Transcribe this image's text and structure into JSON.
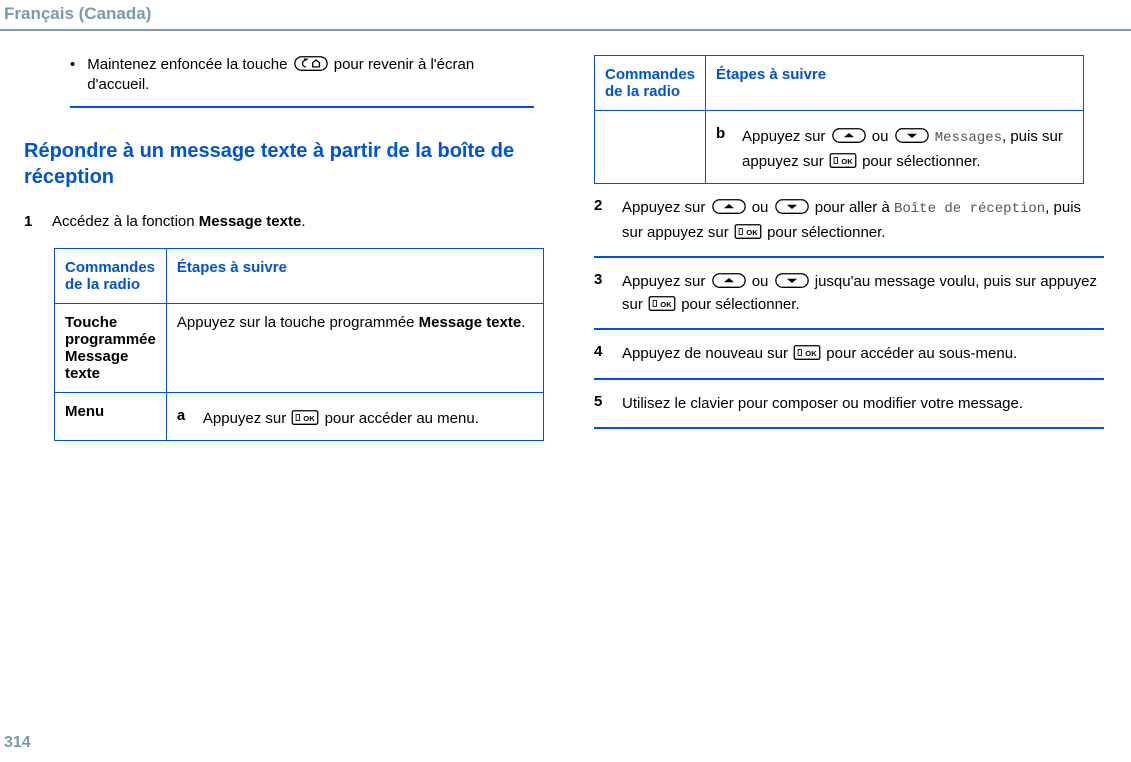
{
  "lang_header": "Français (Canada)",
  "page_number": "314",
  "left": {
    "bullet_pre": "Maintenez enfoncée la touche ",
    "bullet_post": " pour revenir à l'écran d'accueil.",
    "heading": "Répondre à un message texte à partir de la boîte de réception",
    "step1_num": "1",
    "step1_text_pre": "Accédez à la fonction ",
    "step1_text_bold": "Message texte",
    "step1_text_post": ".",
    "table": {
      "h1": "Commandes de la radio",
      "h2": "Étapes à suivre",
      "r1c1_l1": "Touche programmée ",
      "r1c1_bold": "Message texte",
      "r1c2_pre": "Appuyez sur la touche programmée ",
      "r1c2_bold": "Message texte",
      "r1c2_post": ".",
      "r2c1": "Menu",
      "r2_a_lbl": "a",
      "r2_a_pre": "Appuyez sur ",
      "r2_a_post": " pour accéder au menu."
    }
  },
  "right": {
    "table": {
      "h1": "Commandes de la radio",
      "h2": "Étapes à suivre",
      "b_lbl": "b",
      "b_pre": "Appuyez sur ",
      "b_ou": " ou ",
      "b_mid": " ",
      "b_mono": "Messages",
      "b_post1": ", puis sur appuyez sur ",
      "b_post2": " pour sélectionner."
    },
    "step2_num": "2",
    "step2_pre": "Appuyez sur ",
    "step2_ou": " ou ",
    "step2_mid": " pour aller à ",
    "step2_mono": "Boîte de réception",
    "step2_post1": ", puis sur appuyez sur ",
    "step2_post2": " pour sélectionner.",
    "step3_num": "3",
    "step3_pre": "Appuyez sur ",
    "step3_ou": " ou ",
    "step3_mid": " jusqu'au message voulu, puis sur appuyez sur ",
    "step3_post": " pour sélectionner.",
    "step4_num": "4",
    "step4_pre": "Appuyez de nouveau sur ",
    "step4_post": " pour accéder au sous-menu.",
    "step5_num": "5",
    "step5_text": "Utilisez le clavier pour composer ou modifier votre message."
  }
}
